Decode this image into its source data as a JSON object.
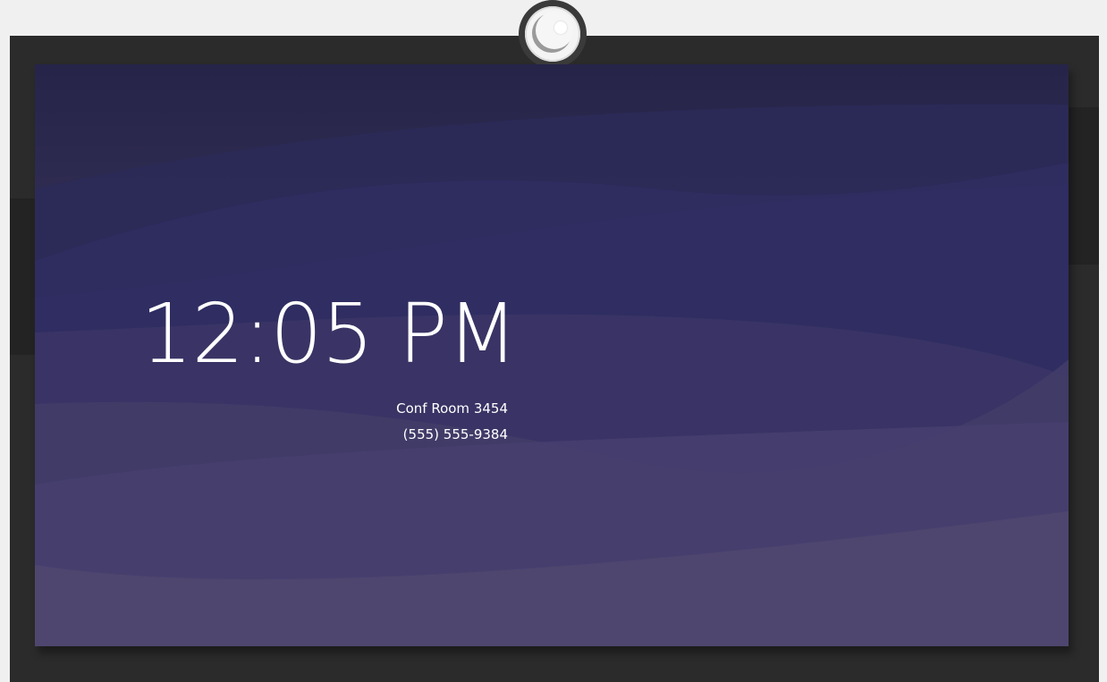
{
  "display": {
    "time": "12:05 PM",
    "room_name": "Conf Room 3454",
    "phone_number": "(555) 555-9384"
  },
  "colors": {
    "bezel": "#2b2b2b",
    "background_top": "#262448",
    "background_bottom": "#514870",
    "text": "#ffffff"
  },
  "icons": {
    "camera": "camera-icon"
  }
}
